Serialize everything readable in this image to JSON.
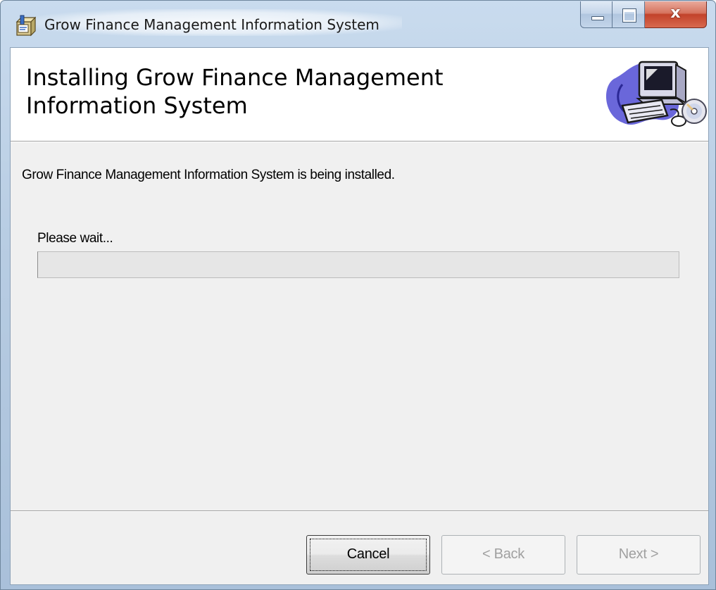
{
  "window": {
    "title": "Grow Finance Management Information System",
    "icon": "installer-package-icon",
    "caption_buttons": {
      "minimize": "minimize-icon",
      "maximize": "maximize-icon",
      "close_label": "x"
    }
  },
  "banner": {
    "heading": "Installing Grow Finance Management Information System",
    "art": "computer-with-cd-icon"
  },
  "body": {
    "status_text": "Grow Finance Management Information System is being installed.",
    "progress": {
      "label": "Please wait...",
      "value": 0
    }
  },
  "buttons": {
    "cancel": "Cancel",
    "back": "< Back",
    "next": "Next >"
  },
  "colors": {
    "client_background": "#f0f0f0",
    "banner_background": "#ffffff",
    "close_button": "#c7432b"
  }
}
